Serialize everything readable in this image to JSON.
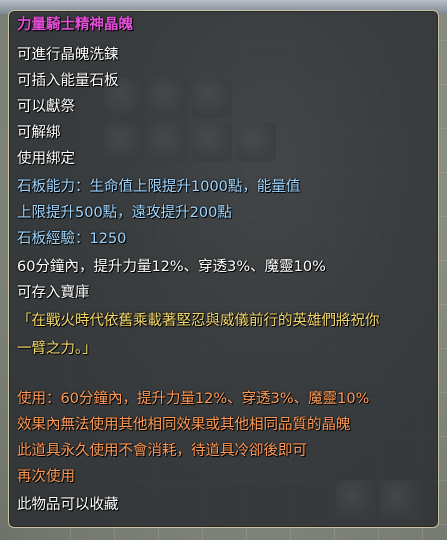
{
  "tooltip": {
    "title": "力量騎士精神晶魄",
    "props": [
      "可進行晶魄洗鍊",
      "可插入能量石板",
      "可以獻祭",
      "可解綁",
      "使用綁定"
    ],
    "stone_ability": [
      "石板能力：生命值上限提升1000點，能量值",
      "上限提升500點，遠攻提升200點"
    ],
    "stone_exp": "石板經驗：1250",
    "effect": "60分鐘內，提升力量12%、穿透3%、魔靈10%",
    "storable": "可存入寶庫",
    "flavor": [
      "「在戰火時代依舊乘載著堅忍與威儀前行的英雄們將祝你",
      "一臂之力。」"
    ],
    "usage": [
      "使用：60分鐘內，提升力量12%、穿透3%、魔靈10%",
      "效果內無法使用其他相同效果或其他相同品質的晶魄",
      "此道具永久使用不會消耗，待道具冷卻後即可",
      "再次使用"
    ],
    "collect": "此物品可以收藏"
  },
  "colors": {
    "title": "#e24fd6",
    "normal": "#ffffff",
    "ability": "#9fd6ff",
    "flavor": "#f4d86c",
    "usage": "#ff9a58"
  }
}
